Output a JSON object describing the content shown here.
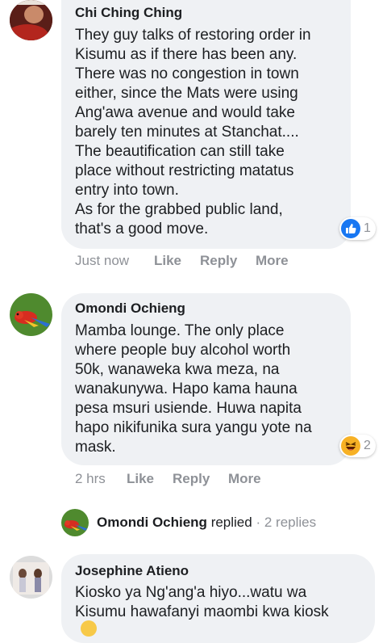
{
  "comments": [
    {
      "author": "Chi Ching Ching",
      "lines": [
        "They guy talks of restoring order in",
        "Kisumu as if there has been any.",
        "There was no congestion in town",
        "either, since the Mats were using",
        "Ang'awa avenue and would take",
        "barely ten minutes at Stanchat....",
        "The beautification can still take",
        "place without restricting matatus",
        "entry into town.",
        "As for the grabbed public land,",
        "that's a good move."
      ],
      "time": "Just now",
      "like": "Like",
      "reply": "Reply",
      "more": "More",
      "reaction": {
        "icon": "like-icon",
        "count": "1",
        "color": "#1877f2"
      }
    },
    {
      "author": "Omondi Ochieng",
      "lines": [
        "Mamba lounge. The only place",
        "where people buy alcohol worth",
        "50k, wanaweka kwa meza, na",
        "wanakunywa. Hapo kama hauna",
        "pesa msuri usiende. Huwa napita",
        "hapo nikifunika sura yangu yote na",
        "mask."
      ],
      "time": "2 hrs",
      "like": "Like",
      "reply": "Reply",
      "more": "More",
      "reaction": {
        "icon": "haha-icon",
        "count": "2",
        "color": "#f7b125"
      }
    },
    {
      "author": "Josephine Atieno",
      "lines": [
        "Kiosko ya Ng'ang'a hiyo...watu wa",
        "Kisumu hawafanyi maombi kwa kiosk"
      ]
    }
  ],
  "reply_summary": {
    "author": "Omondi Ochieng",
    "verb": "replied",
    "separator": "·",
    "count": "2 replies"
  }
}
